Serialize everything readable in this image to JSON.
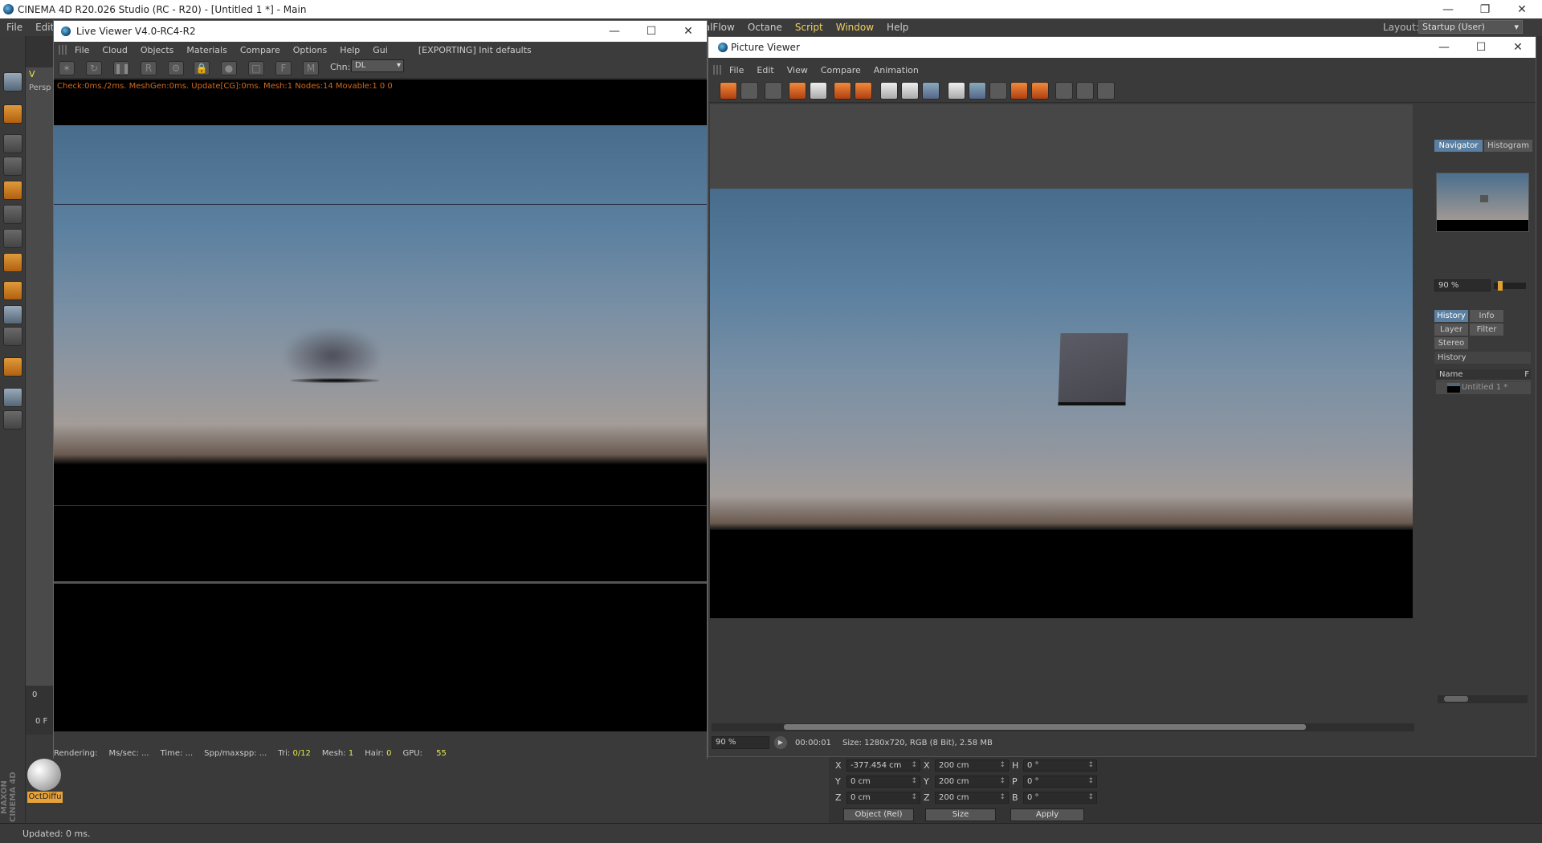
{
  "app": {
    "title": "CINEMA 4D R20.026 Studio (RC - R20) - [Untitled 1 *] - Main"
  },
  "main_menu": {
    "items": [
      "File",
      "Edit",
      "ealFlow",
      "Octane",
      "Script",
      "Window",
      "Help"
    ]
  },
  "layout": {
    "label": "Layout:",
    "value": "Startup (User)"
  },
  "left_panel": {
    "viewport_tab": "V",
    "viewport_label": "Persp",
    "frame_value": "0",
    "frame_field": "0 F"
  },
  "material": {
    "name": "OctDiffu"
  },
  "brand": {
    "text": "MAXON CINEMA 4D"
  },
  "status": {
    "text": "Updated: 0 ms."
  },
  "coordinates": {
    "rows": [
      {
        "axis": "X",
        "pos": "-377.454 cm",
        "size_axis": "X",
        "size": "200 cm",
        "rot_axis": "H",
        "rot": "0 °"
      },
      {
        "axis": "Y",
        "pos": "0 cm",
        "size_axis": "Y",
        "size": "200 cm",
        "rot_axis": "P",
        "rot": "0 °"
      },
      {
        "axis": "Z",
        "pos": "0 cm",
        "size_axis": "Z",
        "size": "200 cm",
        "rot_axis": "B",
        "rot": "0 °"
      }
    ],
    "mode_select": "Object (Rel)",
    "size_select": "Size",
    "apply_label": "Apply"
  },
  "live_viewer": {
    "title": "Live Viewer V4.0-RC4-R2",
    "menu": [
      "File",
      "Cloud",
      "Objects",
      "Materials",
      "Compare",
      "Options",
      "Help",
      "Gui"
    ],
    "exporting": "[EXPORTING] Init defaults",
    "channel_label": "Chn:",
    "channel_value": "DL",
    "check_line": "Check:0ms./2ms. MeshGen:0ms. Update[CG]:0ms. Mesh:1 Nodes:14 Movable:1  0 0",
    "status": {
      "rendering": "Rendering:",
      "ms_sec": "Ms/sec: ...",
      "time": "Time: ...",
      "spp": "Spp/maxspp: ...",
      "tri_label": "Tri:",
      "tri_value": "0/12",
      "mesh_label": "Mesh:",
      "mesh_value": "1",
      "hair_label": "Hair:",
      "hair_value": "0",
      "gpu_label": "GPU:",
      "gpu_value": "55"
    }
  },
  "picture_viewer": {
    "title": "Picture Viewer",
    "menu": [
      "File",
      "Edit",
      "View",
      "Compare",
      "Animation"
    ],
    "zoom": "90 %",
    "timecode": "00:00:01",
    "size_info": "Size: 1280x720, RGB (8 Bit), 2.58 MB",
    "side_tabs": {
      "navigator": "Navigator",
      "histogram": "Histogram"
    },
    "nav_zoom": "90 %",
    "info_tabs": {
      "history": "History",
      "info": "Info",
      "layer": "Layer",
      "filter": "Filter",
      "stereo": "Stereo"
    },
    "history_header": "History",
    "history_col_name": "Name",
    "history_col_extra": "F",
    "history_items": [
      "Untitled 1 *"
    ]
  },
  "colors": {
    "accent_orange": "#e7a23a",
    "check_text": "#d06a1e",
    "gpu_value": "#e8e84a",
    "tab_active": "#5a7fa0"
  }
}
